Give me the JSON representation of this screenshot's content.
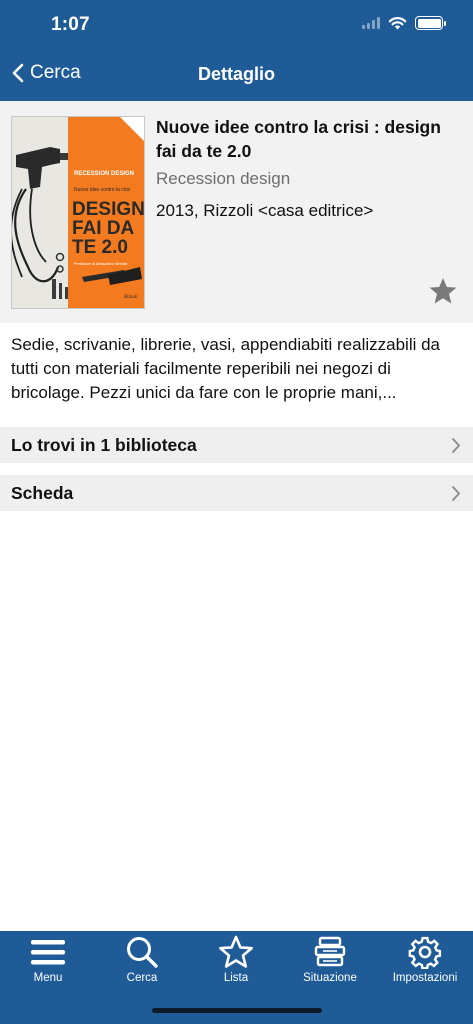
{
  "status_bar": {
    "time": "1:07"
  },
  "nav": {
    "back_label": "Cerca",
    "title": "Dettaglio"
  },
  "book": {
    "title": "Nuove idee contro la crisi : design fai da te 2.0",
    "author": "Recession design",
    "publication": "2013, Rizzoli <casa editrice>",
    "cover": {
      "series": "RECESSION DESIGN",
      "subtitle": "Nuove idee contro la crisi",
      "line1": "DESIGN",
      "line2": "FAI DA",
      "line3": "TE 2.0",
      "preface": "Prefazione di Alessandro Mendini",
      "publisher_mark": "Rizzoli"
    },
    "description": "Sedie, scrivanie, librerie, vasi, appendiabiti realizzabili da tutti con materiali facilmente reperibili nei negozi di bricolage. Pezzi unici da fare con le proprie mani,..."
  },
  "rows": [
    {
      "label": "Lo trovi in 1 biblioteca"
    },
    {
      "label": "Scheda"
    }
  ],
  "tabbar": {
    "items": [
      {
        "label": "Menu",
        "icon": "menu-icon"
      },
      {
        "label": "Cerca",
        "icon": "search-icon"
      },
      {
        "label": "Lista",
        "icon": "star-icon"
      },
      {
        "label": "Situazione",
        "icon": "books-icon"
      },
      {
        "label": "Impostazioni",
        "icon": "gear-icon"
      }
    ]
  },
  "colors": {
    "bar_blue": "#1f5b97",
    "header_gray": "#f2f2f2",
    "cover_orange": "#f47a20"
  }
}
